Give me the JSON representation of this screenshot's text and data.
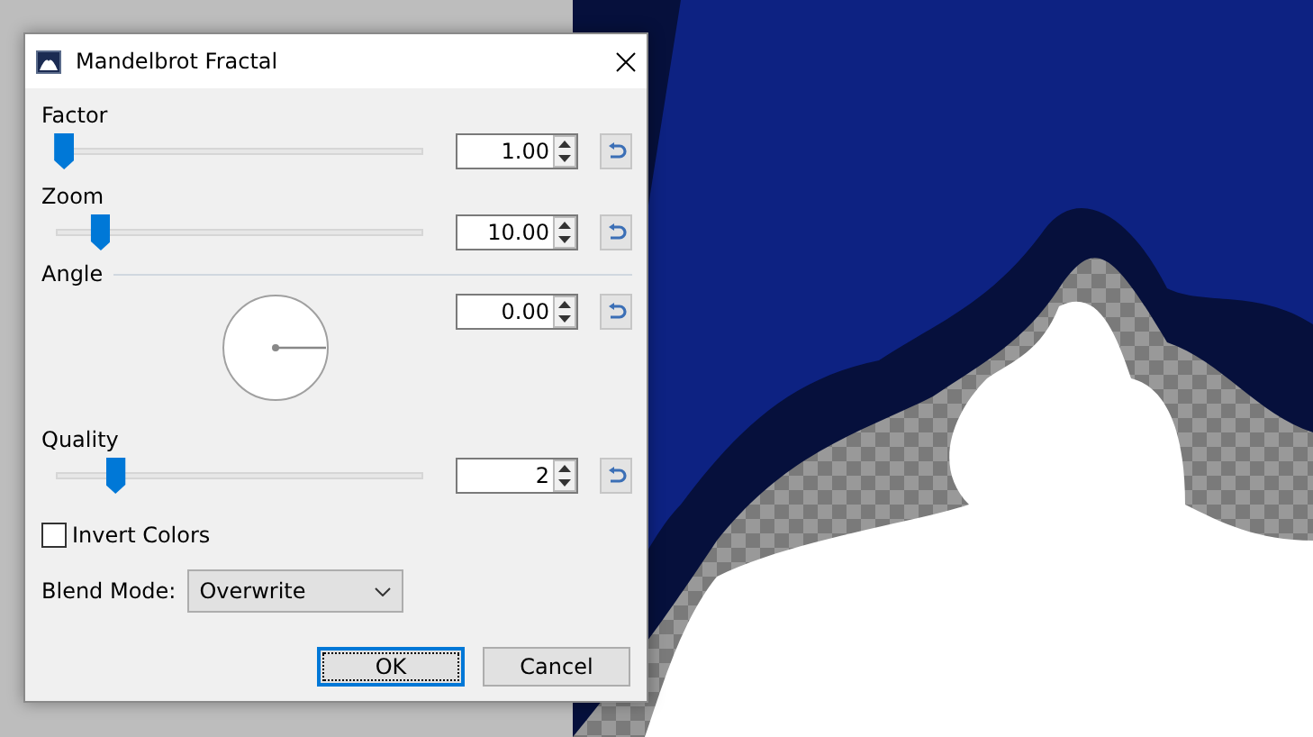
{
  "window": {
    "title": "Mandelbrot Fractal"
  },
  "controls": [
    {
      "kind": "slider",
      "label": "Factor",
      "level": 0.02,
      "value": "1.00"
    },
    {
      "kind": "slider",
      "label": "Zoom",
      "level": 0.12,
      "value": "10.00"
    },
    {
      "kind": "dial",
      "label": "Angle",
      "value": "0.00"
    },
    {
      "kind": "slider",
      "label": "Quality",
      "level": 0.16,
      "value": "2"
    }
  ],
  "invert_colors": {
    "label": "Invert Colors",
    "checked": false
  },
  "blend_mode": {
    "label": "Blend Mode:",
    "value": "Overwrite"
  },
  "buttons": [
    {
      "label": "OK",
      "selected": true
    },
    {
      "label": "Cancel",
      "selected": false
    }
  ]
}
